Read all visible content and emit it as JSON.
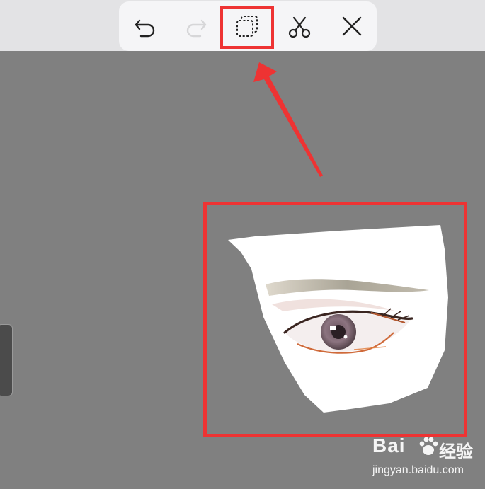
{
  "toolbar": {
    "buttons": [
      {
        "id": "undo",
        "icon": "undo-icon",
        "enabled": true
      },
      {
        "id": "redo",
        "icon": "redo-icon",
        "enabled": false
      },
      {
        "id": "copy",
        "icon": "copy-selection-icon",
        "enabled": true,
        "highlighted": true
      },
      {
        "id": "cut",
        "icon": "scissors-icon",
        "enabled": true
      },
      {
        "id": "close",
        "icon": "close-icon",
        "enabled": true
      }
    ]
  },
  "colors": {
    "canvas": "#808080",
    "topbar": "#e3e3e5",
    "toolbar": "#f5f5f7",
    "annotation": "#ee3333",
    "icon": "#222222",
    "icon_disabled": "#d6d6d8"
  },
  "watermark": {
    "logo": "Bai",
    "suffix": "经验",
    "url": "jingyan.baidu.com"
  }
}
